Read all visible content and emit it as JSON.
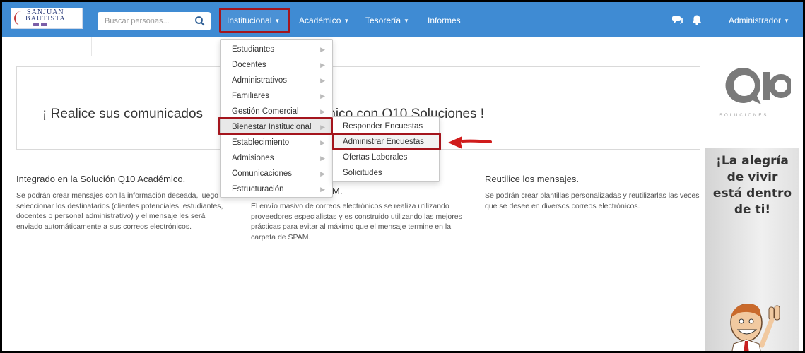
{
  "logo": {
    "line1": "SANJUAN",
    "line2": "BAUTISTA"
  },
  "search": {
    "placeholder": "Buscar personas..."
  },
  "nav": {
    "items": [
      {
        "label": "Institucional"
      },
      {
        "label": "Académico"
      },
      {
        "label": "Tesorería"
      },
      {
        "label": "Informes"
      }
    ],
    "user": "Administrador"
  },
  "banner": {
    "text_before": "¡ Realice sus comunicados ",
    "text_after": "nico con Q10 Soluciones !"
  },
  "columns": [
    {
      "title": "Integrado en la Solución Q10 Académico.",
      "body": "Se podrán crear mensajes con la información deseada, luego seleccionar los destinatarios (clientes potenciales, estudiantes, docentes o personal administrativo) y el mensaje les será enviado automáticamente a sus correos electrónicos."
    },
    {
      "title": "M.",
      "body": "El envío masivo de correos electrónicos se realiza utilizando proveedores especialistas y es construido utilizando las mejores prácticas para evitar al máximo que el mensaje termine en la carpeta de SPAM."
    },
    {
      "title": "Reutilice los mensajes.",
      "body": "Se podrán crear plantillas personalizadas y reutilizarlas las veces que se desee en diversos correos electrónicos."
    }
  ],
  "dropdown": {
    "items": [
      "Estudiantes",
      "Docentes",
      "Administrativos",
      "Familiares",
      "Gestión Comercial",
      "Bienestar Institucional",
      "Establecimiento",
      "Admisiones",
      "Comunicaciones",
      "Estructuración"
    ],
    "active_index": 5
  },
  "submenu": {
    "items": [
      "Responder Encuestas",
      "Administrar Encuestas",
      "Ofertas Laborales",
      "Solicitudes"
    ],
    "active_index": 1
  },
  "ad": {
    "brand_sub": "SOLUCIONES",
    "slogan_1": "¡La alegría",
    "slogan_2": "de vivir",
    "slogan_3": "está dentro",
    "slogan_4": "de ti!"
  },
  "colors": {
    "navbar": "#3f8bd3",
    "highlight": "#a4151d",
    "arrow": "#d01c1c"
  },
  "icons": [
    "search-icon",
    "chat-icon",
    "bell-icon",
    "caret-down-icon",
    "chevron-right-icon",
    "arrow-left-icon"
  ]
}
